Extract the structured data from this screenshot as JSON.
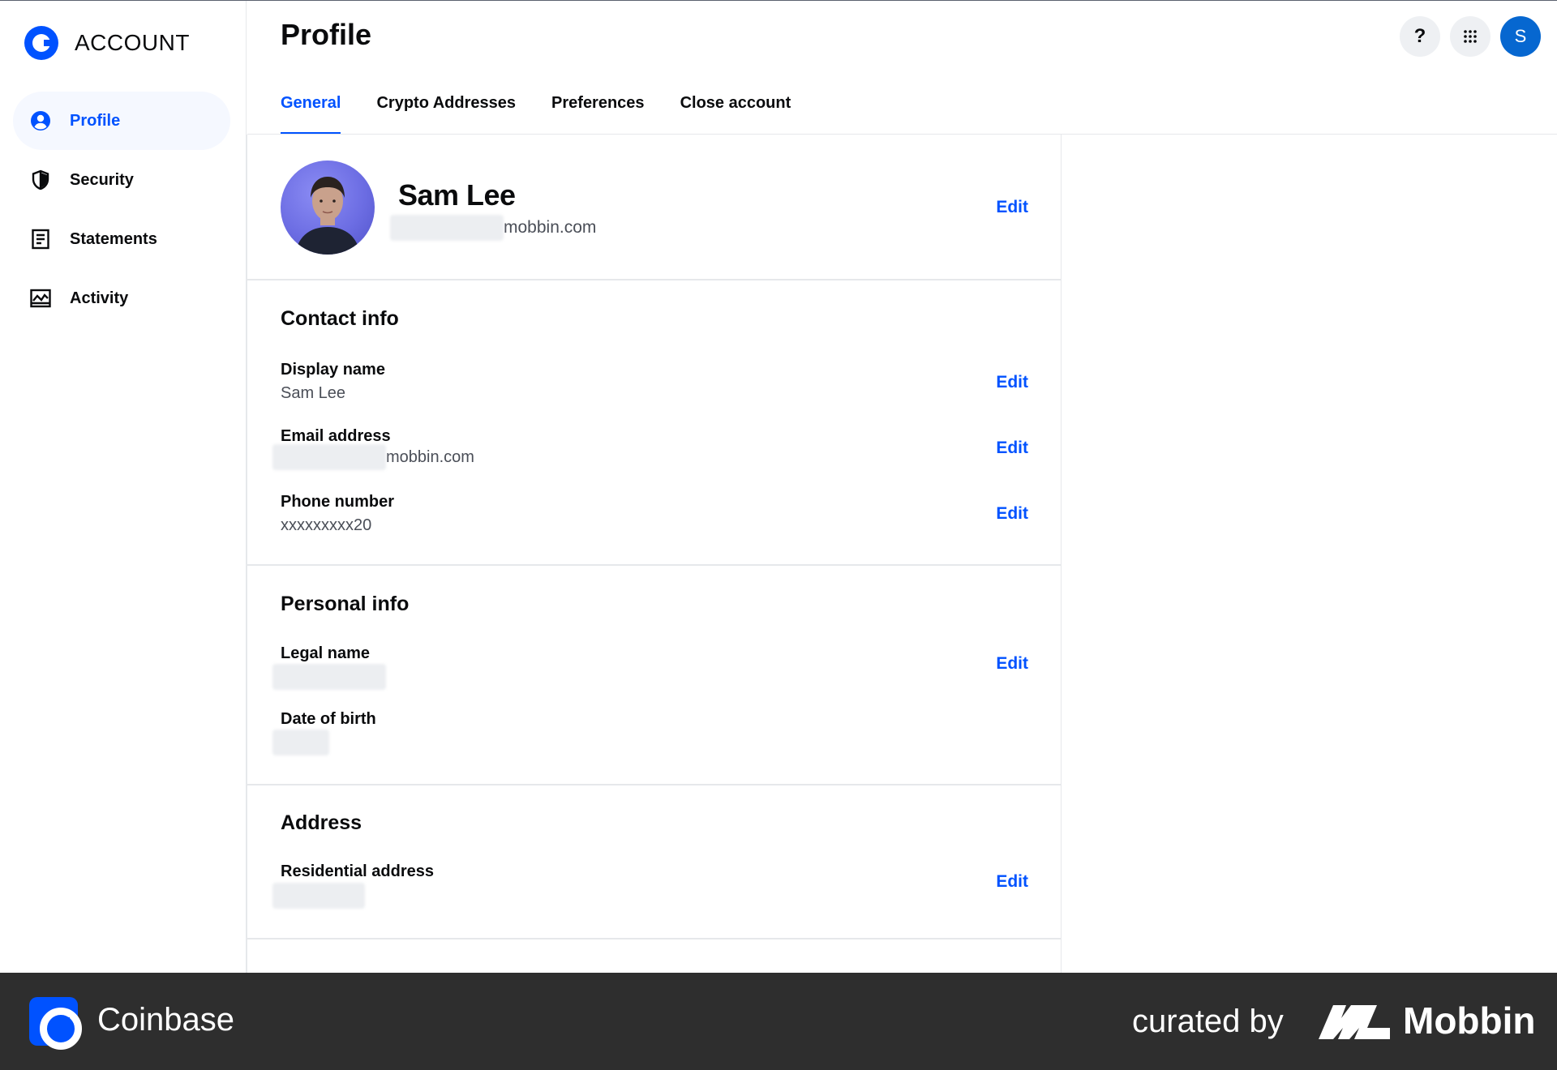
{
  "sidebar": {
    "brand": "ACCOUNT",
    "items": [
      {
        "label": "Profile",
        "icon": "user-circle-icon",
        "active": true
      },
      {
        "label": "Security",
        "icon": "shield-icon"
      },
      {
        "label": "Statements",
        "icon": "document-icon"
      },
      {
        "label": "Activity",
        "icon": "activity-chart-icon"
      }
    ]
  },
  "header": {
    "title": "Profile",
    "help_glyph": "?",
    "avatar_initial": "S"
  },
  "tabs": [
    {
      "label": "General",
      "active": true
    },
    {
      "label": "Crypto Addresses"
    },
    {
      "label": "Preferences"
    },
    {
      "label": "Close account"
    }
  ],
  "profile": {
    "name": "Sam Lee",
    "email_domain": "mobbin.com",
    "edit": "Edit"
  },
  "contact": {
    "title": "Contact info",
    "fields": [
      {
        "label": "Display name",
        "value": "Sam Lee",
        "edit": "Edit"
      },
      {
        "label": "Email address",
        "value": "mobbin.com",
        "edit": "Edit"
      },
      {
        "label": "Phone number",
        "value": "xxxxxxxxx20",
        "edit": "Edit"
      }
    ]
  },
  "personal": {
    "title": "Personal info",
    "fields": [
      {
        "label": "Legal name",
        "edit": "Edit"
      },
      {
        "label": "Date of birth"
      }
    ]
  },
  "address": {
    "title": "Address",
    "fields": [
      {
        "label": "Residential address",
        "edit": "Edit"
      }
    ]
  },
  "footer": {
    "app_name": "Coinbase",
    "curated_by": "curated by",
    "brand": "Mobbin"
  },
  "colors": {
    "accent": "#0052ff",
    "avatar": "#0667d0",
    "footer_bg": "#2e2e2e"
  }
}
